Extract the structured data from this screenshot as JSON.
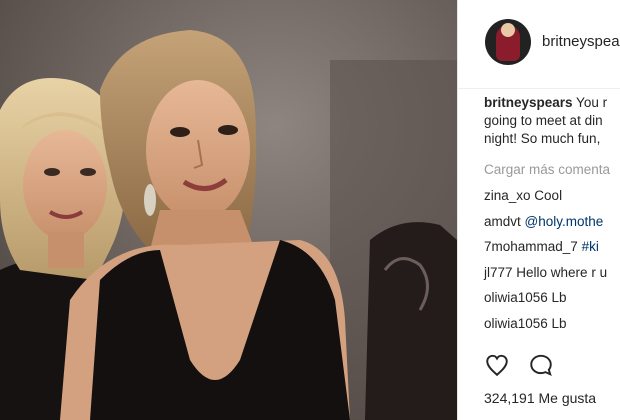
{
  "post": {
    "username": "britneyspears",
    "caption": {
      "username": "britneyspears",
      "line1": " You r",
      "line2": "going to meet at din",
      "line3": "night! So much fun,"
    },
    "load_more": "Cargar más comenta",
    "comments": [
      {
        "user": "zina_xo",
        "text": " Cool",
        "mention": ""
      },
      {
        "user": "amdvt",
        "text": " ",
        "mention": "@holy.mothe"
      },
      {
        "user": "7mohammad_7",
        "text": " ",
        "mention": "#ki"
      },
      {
        "user": "jl777",
        "text": " Hello where r u",
        "mention": ""
      },
      {
        "user": "oliwia1056",
        "text": " Lb",
        "mention": ""
      },
      {
        "user": "oliwia1056",
        "text": " Lb",
        "mention": ""
      }
    ],
    "likes": "324,191 Me gusta"
  },
  "icons": {
    "like": "heart-icon",
    "comment": "comment-bubble-icon"
  },
  "colors": {
    "text": "#262626",
    "muted": "#999999",
    "link": "#003569"
  }
}
